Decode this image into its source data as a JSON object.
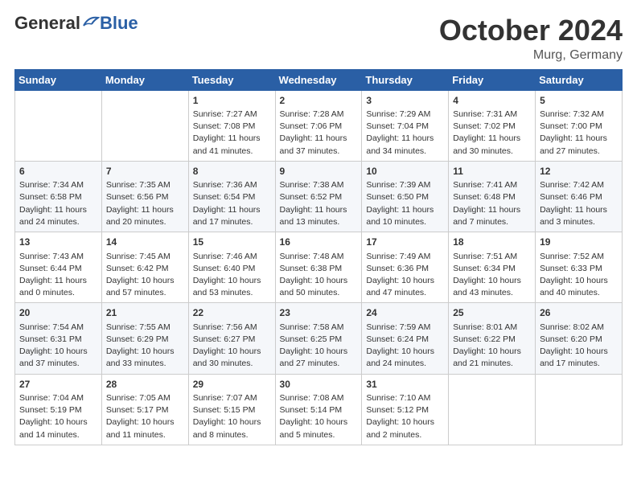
{
  "header": {
    "logo_general": "General",
    "logo_blue": "Blue",
    "month_title": "October 2024",
    "location": "Murg, Germany"
  },
  "weekdays": [
    "Sunday",
    "Monday",
    "Tuesday",
    "Wednesday",
    "Thursday",
    "Friday",
    "Saturday"
  ],
  "weeks": [
    [
      {
        "day": "",
        "content": ""
      },
      {
        "day": "",
        "content": ""
      },
      {
        "day": "1",
        "content": "Sunrise: 7:27 AM\nSunset: 7:08 PM\nDaylight: 11 hours and 41 minutes."
      },
      {
        "day": "2",
        "content": "Sunrise: 7:28 AM\nSunset: 7:06 PM\nDaylight: 11 hours and 37 minutes."
      },
      {
        "day": "3",
        "content": "Sunrise: 7:29 AM\nSunset: 7:04 PM\nDaylight: 11 hours and 34 minutes."
      },
      {
        "day": "4",
        "content": "Sunrise: 7:31 AM\nSunset: 7:02 PM\nDaylight: 11 hours and 30 minutes."
      },
      {
        "day": "5",
        "content": "Sunrise: 7:32 AM\nSunset: 7:00 PM\nDaylight: 11 hours and 27 minutes."
      }
    ],
    [
      {
        "day": "6",
        "content": "Sunrise: 7:34 AM\nSunset: 6:58 PM\nDaylight: 11 hours and 24 minutes."
      },
      {
        "day": "7",
        "content": "Sunrise: 7:35 AM\nSunset: 6:56 PM\nDaylight: 11 hours and 20 minutes."
      },
      {
        "day": "8",
        "content": "Sunrise: 7:36 AM\nSunset: 6:54 PM\nDaylight: 11 hours and 17 minutes."
      },
      {
        "day": "9",
        "content": "Sunrise: 7:38 AM\nSunset: 6:52 PM\nDaylight: 11 hours and 13 minutes."
      },
      {
        "day": "10",
        "content": "Sunrise: 7:39 AM\nSunset: 6:50 PM\nDaylight: 11 hours and 10 minutes."
      },
      {
        "day": "11",
        "content": "Sunrise: 7:41 AM\nSunset: 6:48 PM\nDaylight: 11 hours and 7 minutes."
      },
      {
        "day": "12",
        "content": "Sunrise: 7:42 AM\nSunset: 6:46 PM\nDaylight: 11 hours and 3 minutes."
      }
    ],
    [
      {
        "day": "13",
        "content": "Sunrise: 7:43 AM\nSunset: 6:44 PM\nDaylight: 11 hours and 0 minutes."
      },
      {
        "day": "14",
        "content": "Sunrise: 7:45 AM\nSunset: 6:42 PM\nDaylight: 10 hours and 57 minutes."
      },
      {
        "day": "15",
        "content": "Sunrise: 7:46 AM\nSunset: 6:40 PM\nDaylight: 10 hours and 53 minutes."
      },
      {
        "day": "16",
        "content": "Sunrise: 7:48 AM\nSunset: 6:38 PM\nDaylight: 10 hours and 50 minutes."
      },
      {
        "day": "17",
        "content": "Sunrise: 7:49 AM\nSunset: 6:36 PM\nDaylight: 10 hours and 47 minutes."
      },
      {
        "day": "18",
        "content": "Sunrise: 7:51 AM\nSunset: 6:34 PM\nDaylight: 10 hours and 43 minutes."
      },
      {
        "day": "19",
        "content": "Sunrise: 7:52 AM\nSunset: 6:33 PM\nDaylight: 10 hours and 40 minutes."
      }
    ],
    [
      {
        "day": "20",
        "content": "Sunrise: 7:54 AM\nSunset: 6:31 PM\nDaylight: 10 hours and 37 minutes."
      },
      {
        "day": "21",
        "content": "Sunrise: 7:55 AM\nSunset: 6:29 PM\nDaylight: 10 hours and 33 minutes."
      },
      {
        "day": "22",
        "content": "Sunrise: 7:56 AM\nSunset: 6:27 PM\nDaylight: 10 hours and 30 minutes."
      },
      {
        "day": "23",
        "content": "Sunrise: 7:58 AM\nSunset: 6:25 PM\nDaylight: 10 hours and 27 minutes."
      },
      {
        "day": "24",
        "content": "Sunrise: 7:59 AM\nSunset: 6:24 PM\nDaylight: 10 hours and 24 minutes."
      },
      {
        "day": "25",
        "content": "Sunrise: 8:01 AM\nSunset: 6:22 PM\nDaylight: 10 hours and 21 minutes."
      },
      {
        "day": "26",
        "content": "Sunrise: 8:02 AM\nSunset: 6:20 PM\nDaylight: 10 hours and 17 minutes."
      }
    ],
    [
      {
        "day": "27",
        "content": "Sunrise: 7:04 AM\nSunset: 5:19 PM\nDaylight: 10 hours and 14 minutes."
      },
      {
        "day": "28",
        "content": "Sunrise: 7:05 AM\nSunset: 5:17 PM\nDaylight: 10 hours and 11 minutes."
      },
      {
        "day": "29",
        "content": "Sunrise: 7:07 AM\nSunset: 5:15 PM\nDaylight: 10 hours and 8 minutes."
      },
      {
        "day": "30",
        "content": "Sunrise: 7:08 AM\nSunset: 5:14 PM\nDaylight: 10 hours and 5 minutes."
      },
      {
        "day": "31",
        "content": "Sunrise: 7:10 AM\nSunset: 5:12 PM\nDaylight: 10 hours and 2 minutes."
      },
      {
        "day": "",
        "content": ""
      },
      {
        "day": "",
        "content": ""
      }
    ]
  ]
}
